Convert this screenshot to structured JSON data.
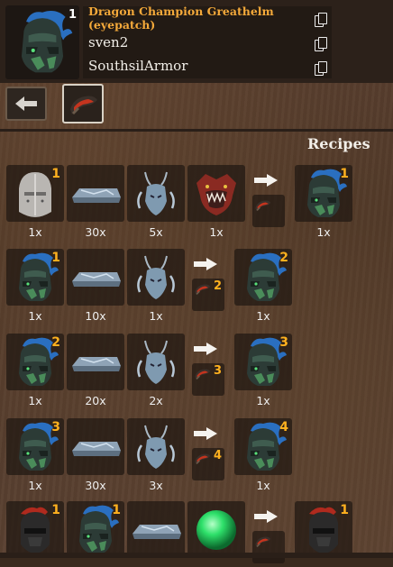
{
  "header": {
    "item_name": "Dragon Champion Greathelm (eyepatch)",
    "item_count": "1",
    "owner": "sven2",
    "mod": "SouthsilArmor",
    "item_icon": "dragon-greathelm-icon",
    "copy_icon": "copy-icon"
  },
  "toolbar": {
    "back_icon": "back-arrow-icon",
    "tool_icon": "forge-hammer-icon"
  },
  "section_label": "Recipes",
  "colors": {
    "accent": "#f4a93a",
    "count": "#ffb11f",
    "panel": "#221a14"
  },
  "recipes": [
    {
      "inputs": [
        {
          "icon": "silver-helm-icon",
          "count": "1",
          "qty": "1x"
        },
        {
          "icon": "metal-bar-icon",
          "qty": "30x"
        },
        {
          "icon": "dragon-claws-icon",
          "qty": "5x"
        },
        {
          "icon": "dragon-head-icon",
          "qty": "1x"
        }
      ],
      "tool": {
        "icon": "forge-hammer-icon"
      },
      "output": {
        "icon": "dragon-greathelm-icon",
        "count": "1",
        "qty": "1x"
      }
    },
    {
      "inputs": [
        {
          "icon": "dragon-greathelm-icon",
          "count": "1",
          "qty": "1x"
        },
        {
          "icon": "metal-bar-icon",
          "qty": "10x"
        },
        {
          "icon": "dragon-claws-icon",
          "qty": "1x"
        }
      ],
      "tool": {
        "icon": "forge-hammer-icon",
        "count": "2"
      },
      "output": {
        "icon": "dragon-greathelm-icon",
        "count": "2",
        "qty": "1x"
      }
    },
    {
      "inputs": [
        {
          "icon": "dragon-greathelm-icon",
          "count": "2",
          "qty": "1x"
        },
        {
          "icon": "metal-bar-icon",
          "qty": "20x"
        },
        {
          "icon": "dragon-claws-icon",
          "qty": "2x"
        }
      ],
      "tool": {
        "icon": "forge-hammer-icon",
        "count": "3"
      },
      "output": {
        "icon": "dragon-greathelm-icon",
        "count": "3",
        "qty": "1x"
      }
    },
    {
      "inputs": [
        {
          "icon": "dragon-greathelm-icon",
          "count": "3",
          "qty": "1x"
        },
        {
          "icon": "metal-bar-icon",
          "qty": "30x"
        },
        {
          "icon": "dragon-claws-icon",
          "qty": "3x"
        }
      ],
      "tool": {
        "icon": "forge-hammer-icon",
        "count": "4"
      },
      "output": {
        "icon": "dragon-greathelm-icon",
        "count": "4",
        "qty": "1x"
      }
    },
    {
      "inputs": [
        {
          "icon": "dark-helm-red-icon",
          "count": "1"
        },
        {
          "icon": "dragon-greathelm-icon",
          "count": "1"
        },
        {
          "icon": "metal-bar-icon"
        },
        {
          "icon": "green-orb-icon"
        }
      ],
      "tool": {
        "icon": "forge-hammer-icon"
      },
      "output": {
        "icon": "dark-helm-red-icon",
        "count": "1"
      }
    }
  ]
}
